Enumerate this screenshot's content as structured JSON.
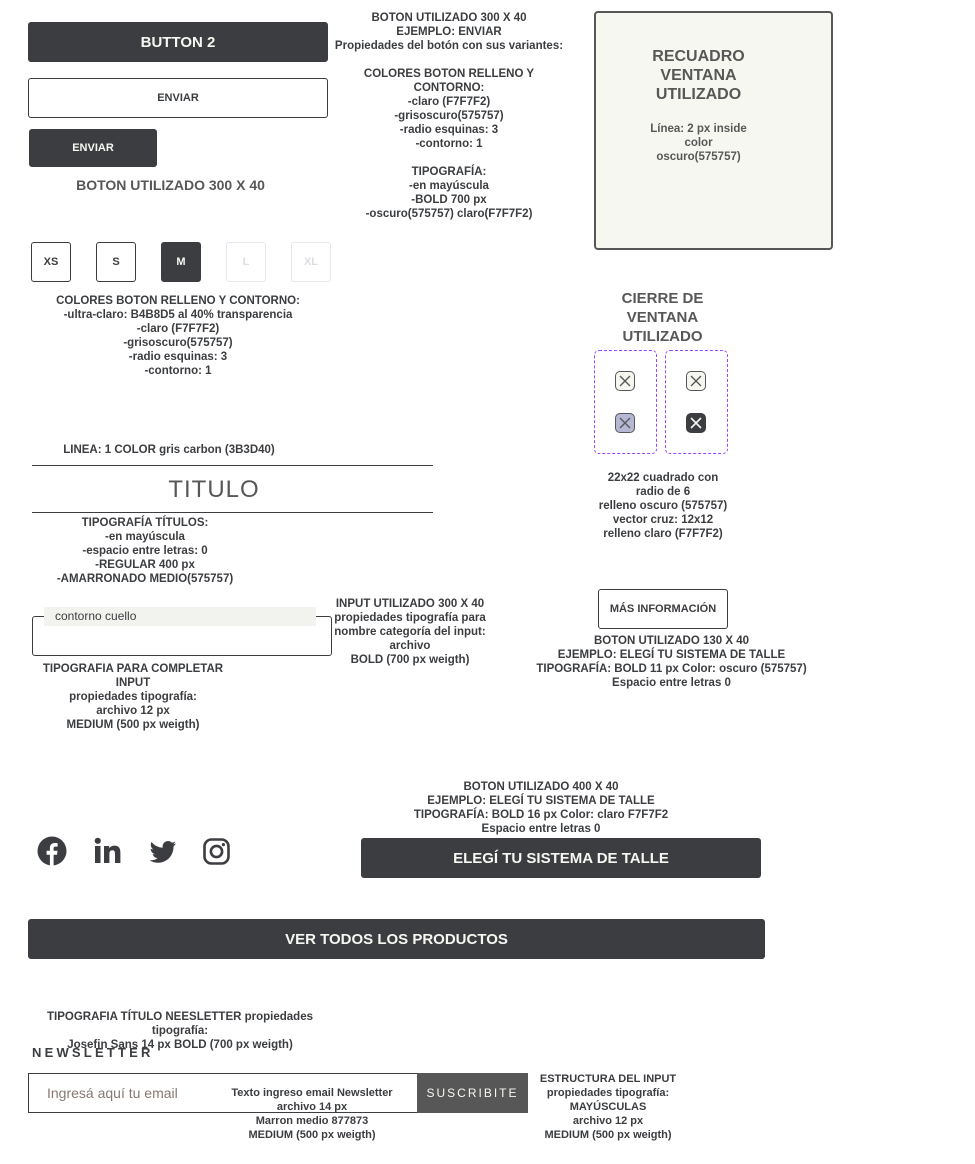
{
  "buttons": {
    "button2": "BUTTON 2",
    "enviar_outline": "ENVIAR",
    "enviar_dark": "ENVIAR",
    "caption_300x40": "BOTON UTILIZADO 300 X 40"
  },
  "notes": {
    "boton_300": "BOTON UTILIZADO 300 X 40\nEJEMPLO: ENVIAR\nPropiedades del botón con sus variantes:\n\nCOLORES BOTON RELLENO Y\nCONTORNO:\n-claro (F7F7F2)\n-grisoscuro(575757)\n-radio esquinas: 3\n-contorno: 1\n\nTIPOGRAFÍA:\n-en mayúscula\n-BOLD 700 px\n-oscuro(575757) claro(F7F7F2)",
    "sizes_colors": "COLORES BOTON RELLENO Y CONTORNO:\n-ultra-claro:  B4B8D5 al 40% transparencia\n-claro (F7F7F2)\n-grisoscuro(575757)\n-radio esquinas: 3\n-contorno: 1",
    "linea": "LINEA:  1  COLOR gris carbon (3B3D40)",
    "tipografia_titulos": "TIPOGRAFÍA TÍTULOS:\n-en mayúscula\n-espacio entre letras: 0\n-REGULAR 400 px\n-AMARRONADO MEDIO(575757)",
    "input_300": "INPUT UTILIZADO 300 X 40\npropiedades tipografía para\nnombre categoría del input:\narchivo\nBOLD (700 px weigth)",
    "tipografia_input": "TIPOGRAFIA PARA COMPLETAR INPUT\npropiedades tipografía:\narchivo 12 px\nMEDIUM (500 px weigth)",
    "boton_130": "BOTON UTILIZADO 130 X 40\nEJEMPLO: ELEGÍ TU SISTEMA DE TALLE\nTIPOGRAFÍA: BOLD 11 px Color: oscuro (575757)\nEspacio entre letras 0",
    "cierre_spec": "22x22 cuadrado con\nradio de 6\nrelleno oscuro (575757)\nvector cruz: 12x12\nrelleno claro (F7F7F2)",
    "boton_400": "BOTON UTILIZADO 400 X 40\nEJEMPLO: ELEGÍ TU SISTEMA DE TALLE\nTIPOGRAFÍA: BOLD 16 px Color: claro F7F7F2\nEspacio entre letras 0",
    "newsletter_title": "TIPOGRAFIA TÍTULO NEESLETTER propiedades tipografía:\nJosefin Sans  14 px BOLD (700 px weigth)",
    "newsletter_input": "Texto ingreso email Newsletter\narchivo 14 px\nMarron medio 877873\nMEDIUM (500 px weigth)",
    "estructura_input": "ESTRUCTURA DEL INPUT\npropiedades tipografía:\nMAYÚSCULAS\narchivo 12 px\nMEDIUM (500 px weigth)"
  },
  "window_box": {
    "title": "RECUADRO\nVENTANA\nUTILIZADO",
    "desc": "Línea:  2 px inside\ncolor\noscuro(575757)"
  },
  "close_title": "CIERRE DE\nVENTANA\nUTILIZADO",
  "sizes": [
    {
      "label": "XS",
      "state": "default"
    },
    {
      "label": "S",
      "state": "default"
    },
    {
      "label": "M",
      "state": "selected"
    },
    {
      "label": "L",
      "state": "disabled"
    },
    {
      "label": "XL",
      "state": "disabled"
    }
  ],
  "titulo": "TITULO",
  "input_cuello": "contorno cuello",
  "mas_info": "MÁS INFORMACIÓN",
  "elegi_talle": "ELEGÍ TU SISTEMA DE TALLE",
  "ver_todos": "VER TODOS LOS PRODUCTOS",
  "newsletter": {
    "heading": "NEWSLETTER",
    "placeholder": "Ingresá aquí tu email",
    "submit": "SUSCRIBITE"
  },
  "social_icons": [
    "facebook-icon",
    "linkedin-icon",
    "twitter-icon",
    "instagram-icon"
  ],
  "colors": {
    "dark": "#3b3d40",
    "light": "#f7f7f2",
    "ultra_light": "#b4b8d5",
    "accent_dashed": "#9747ff"
  }
}
